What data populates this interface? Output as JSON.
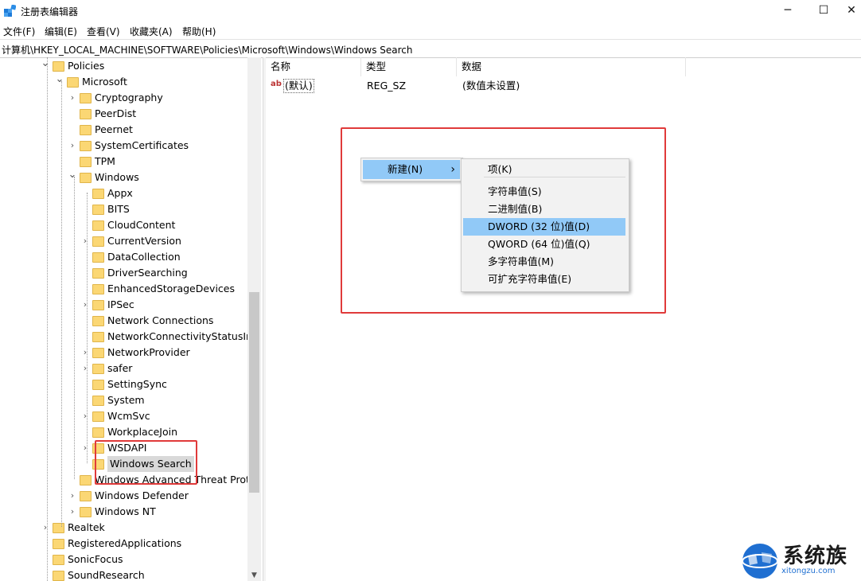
{
  "window": {
    "title": "注册表编辑器",
    "minimize_glyph": "─",
    "maximize_glyph": "☐",
    "close_glyph": "✕"
  },
  "menu": [
    "文件(F)",
    "编辑(E)",
    "查看(V)",
    "收藏夹(A)",
    "帮助(H)"
  ],
  "address": "计算机\\HKEY_LOCAL_MACHINE\\SOFTWARE\\Policies\\Microsoft\\Windows\\Windows Search",
  "tree": [
    {
      "label": "Policies",
      "expanded": true
    },
    {
      "label": "Microsoft",
      "expanded": true
    },
    {
      "label": "Cryptography",
      "expandable": true
    },
    {
      "label": "PeerDist",
      "expandable": false
    },
    {
      "label": "Peernet",
      "expandable": false
    },
    {
      "label": "SystemCertificates",
      "expandable": true
    },
    {
      "label": "TPM",
      "expandable": false
    },
    {
      "label": "Windows",
      "expanded": true
    },
    {
      "label": "Appx",
      "expandable": false
    },
    {
      "label": "BITS",
      "expandable": false
    },
    {
      "label": "CloudContent",
      "expandable": false
    },
    {
      "label": "CurrentVersion",
      "expandable": true
    },
    {
      "label": "DataCollection",
      "expandable": false
    },
    {
      "label": "DriverSearching",
      "expandable": false
    },
    {
      "label": "EnhancedStorageDevices",
      "expandable": false
    },
    {
      "label": "IPSec",
      "expandable": true
    },
    {
      "label": "Network Connections",
      "expandable": false
    },
    {
      "label": "NetworkConnectivityStatusIndi",
      "expandable": false
    },
    {
      "label": "NetworkProvider",
      "expandable": true
    },
    {
      "label": "safer",
      "expandable": true
    },
    {
      "label": "SettingSync",
      "expandable": false
    },
    {
      "label": "System",
      "expandable": false
    },
    {
      "label": "WcmSvc",
      "expandable": true
    },
    {
      "label": "WorkplaceJoin",
      "expandable": false
    },
    {
      "label": "WSDAPI",
      "expandable": true
    },
    {
      "label": "Windows Search",
      "expandable": false,
      "selected": true
    },
    {
      "label": "Windows Advanced Threat Prote",
      "expandable": false
    },
    {
      "label": "Windows Defender",
      "expandable": true
    },
    {
      "label": "Windows NT",
      "expandable": true
    },
    {
      "label": "Realtek",
      "expandable": true
    },
    {
      "label": "RegisteredApplications",
      "expandable": false
    },
    {
      "label": "SonicFocus",
      "expandable": false
    },
    {
      "label": "SoundResearch",
      "expandable": false
    }
  ],
  "scroll": {
    "up_glyph": "▲",
    "down_glyph": "▼"
  },
  "list": {
    "columns": [
      "名称",
      "类型",
      "数据"
    ],
    "rows": [
      {
        "name": "(默认)",
        "type": "REG_SZ",
        "data": "(数值未设置)",
        "icon": "string-value-icon",
        "icon_text": "ab"
      }
    ]
  },
  "context_menu": {
    "item": "新建(N)",
    "arrow": "›",
    "submenu": [
      "项(K)",
      "字符串值(S)",
      "二进制值(B)",
      "DWORD (32 位)值(D)",
      "QWORD (64 位)值(Q)",
      "多字符串值(M)",
      "可扩充字符串值(E)"
    ],
    "highlighted_index": 3
  },
  "watermark": {
    "text": "系统族",
    "url": "xitongzu.com"
  },
  "colors": {
    "highlight": "#91c9f7",
    "annotation_red": "#e03a3a",
    "folder": "#fbd774"
  }
}
